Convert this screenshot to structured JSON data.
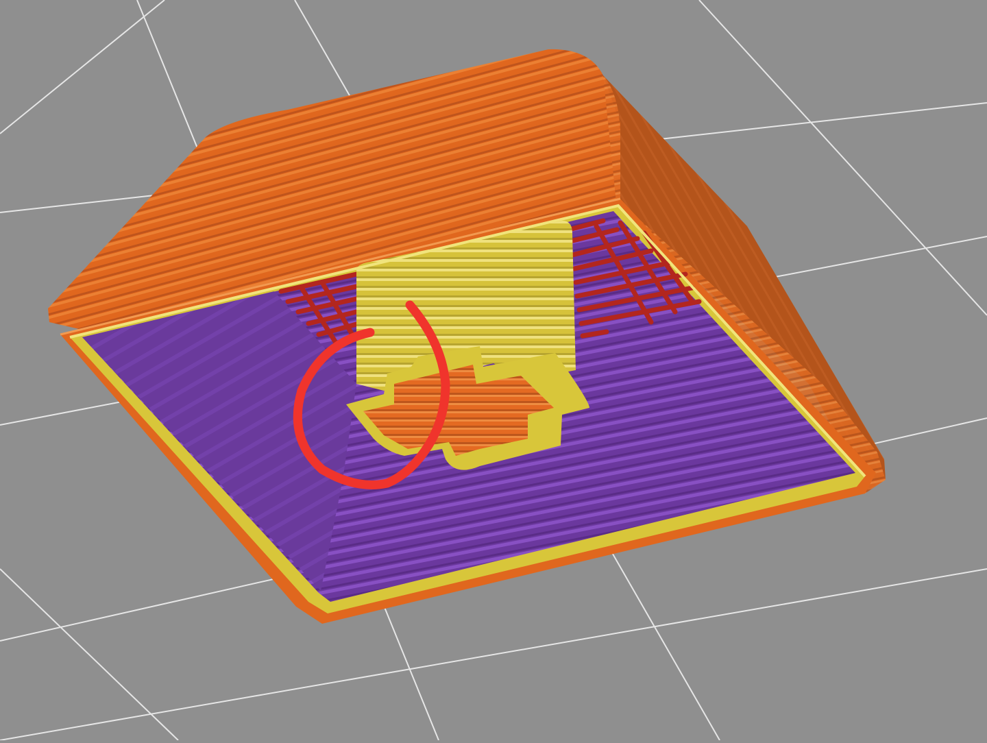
{
  "viewport": {
    "background": "#8f8f8f",
    "grid_color": "#e6e6e6"
  },
  "colors": {
    "outer_wall": "#e0671e",
    "outer_wall_dark": "#b4541b",
    "outer_wall_line": "#f08a3c",
    "inner_wall": "#d8c63a",
    "inner_wall_light": "#efe06a",
    "solid_infill": "#6f3ba3",
    "solid_infill_line": "#8c52c8",
    "sparse_infill": "#b3261e",
    "stem_internal": "#e46a22",
    "annotation": "#f0342c"
  },
  "annotation": {
    "shape": "hand-drawn-red-circle",
    "target": "keycap-stem-cross-corner"
  }
}
